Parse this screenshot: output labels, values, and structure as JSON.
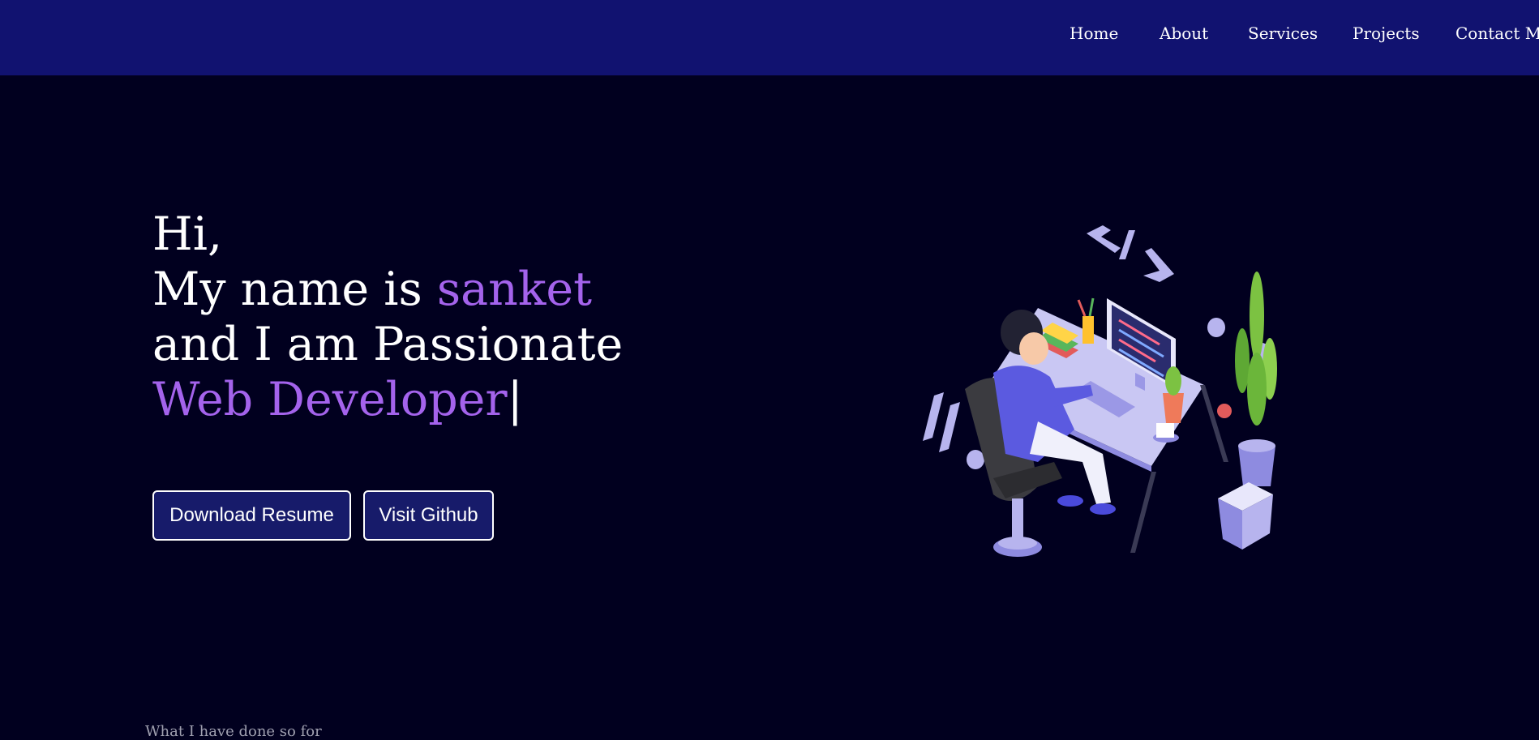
{
  "nav": {
    "items": [
      {
        "label": "Home"
      },
      {
        "label": "About"
      },
      {
        "label": "Services"
      },
      {
        "label": "Projects"
      },
      {
        "label": "Contact Me"
      }
    ]
  },
  "hero": {
    "greeting": "Hi,",
    "name_prefix": "My name is ",
    "name": "sanket",
    "passion_line": "and I am Passionate",
    "role": "Web Developer",
    "cursor": "|"
  },
  "buttons": {
    "download_resume": "Download Resume",
    "visit_github": "Visit Github"
  },
  "section": {
    "caption": "What I have done so for"
  },
  "colors": {
    "navbar_bg": "#111270",
    "page_bg": "#01001f",
    "accent": "#a463ec",
    "button_bg": "#171b6a"
  },
  "illustration": {
    "icon": "developer-at-desk-illustration"
  }
}
